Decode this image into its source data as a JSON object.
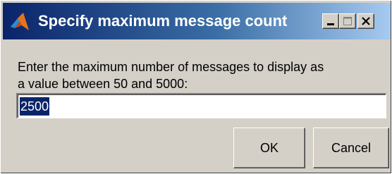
{
  "window": {
    "title": "Specify maximum message count"
  },
  "titlebar_buttons": {
    "minimize": "minimize-icon",
    "maximize": "maximize-icon",
    "close": "close-icon"
  },
  "prompt": {
    "line1": "Enter the maximum number of messages to display as",
    "line2": "a value between 50 and 5000:"
  },
  "input": {
    "value": "2500"
  },
  "buttons": {
    "ok": "OK",
    "cancel": "Cancel"
  },
  "colors": {
    "title_gradient_start": "#0a246a",
    "title_gradient_end": "#a6caf0",
    "dialog_face": "#d4d0c8",
    "selection": "#0a246a"
  }
}
